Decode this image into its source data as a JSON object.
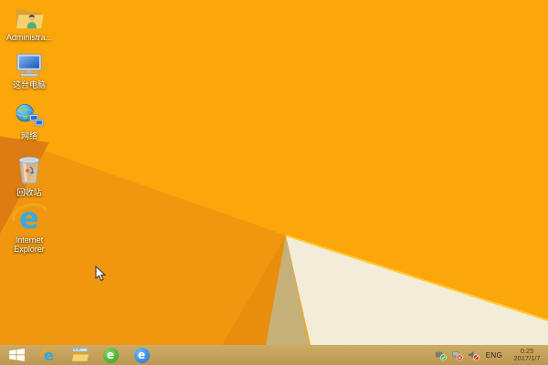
{
  "colors": {
    "base": "#FBA60B",
    "facet_mid": "#F0970F",
    "facet_dark_wedge": "#E98D0C",
    "facet_dark_triangle": "#DD7C12",
    "facet_tan": "#C6B07A",
    "facet_cream": "#F3ECD9",
    "facet_highlight": "#FFC937",
    "taskbar": "#C4A35C"
  },
  "desktop": {
    "icons": [
      {
        "label": "Administra..."
      },
      {
        "label": "这台电脑"
      },
      {
        "label": "网络"
      },
      {
        "label": "回收站"
      },
      {
        "label": "Internet Explorer"
      }
    ]
  },
  "taskbar": {
    "tray": {
      "language": "ENG",
      "time": "0:25",
      "date": "2017/1/7"
    }
  }
}
